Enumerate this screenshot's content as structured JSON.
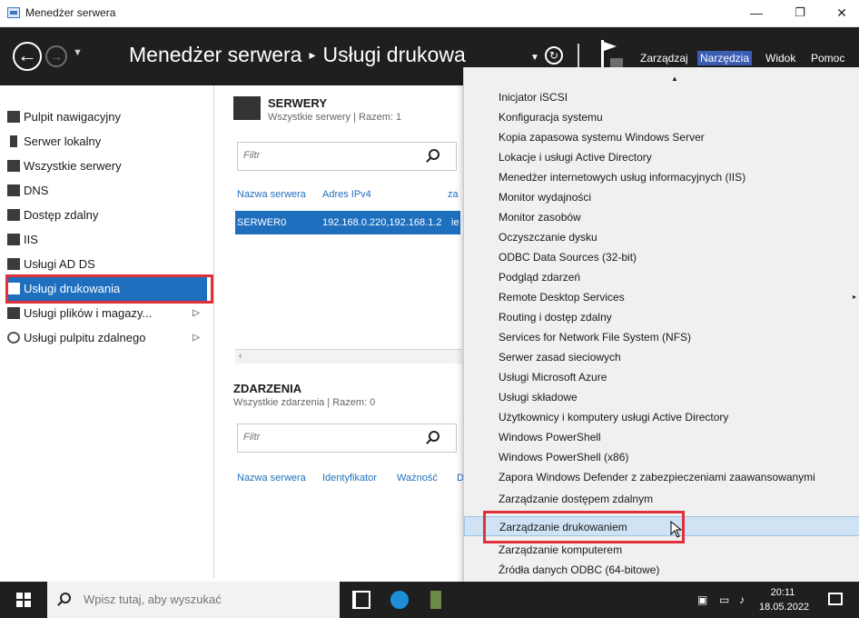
{
  "window": {
    "title": "Menedżer serwera",
    "minimize": "—",
    "maximize": "❐",
    "close": "✕"
  },
  "header": {
    "breadcrumb_root": "Menedżer serwera",
    "breadcrumb_sep": "▸",
    "breadcrumb_current": "Usługi drukowania",
    "menus": [
      "Zarządzaj",
      "Narzędzia",
      "Widok",
      "Pomoc"
    ],
    "active_menu": "Narzędzia"
  },
  "sidebar": {
    "items": [
      {
        "label": "Pulpit nawigacyjny",
        "icon": "dashboard-icon"
      },
      {
        "label": "Serwer lokalny",
        "icon": "server-icon"
      },
      {
        "label": "Wszystkie serwery",
        "icon": "servers-icon"
      },
      {
        "label": "DNS",
        "icon": "dns-icon"
      },
      {
        "label": "Dostęp zdalny",
        "icon": "remote-access-icon"
      },
      {
        "label": "IIS",
        "icon": "iis-icon"
      },
      {
        "label": "Usługi AD DS",
        "icon": "ad-ds-icon"
      },
      {
        "label": "Usługi drukowania",
        "icon": "printer-icon",
        "selected": true
      },
      {
        "label": "Usługi plików i magazy...",
        "icon": "file-storage-icon",
        "arrow": "▷"
      },
      {
        "label": "Usługi pulpitu zdalnego",
        "icon": "remote-desktop-icon",
        "arrow": "▷"
      }
    ]
  },
  "servers_tile": {
    "title": "SERWERY",
    "subtitle": "Wszystkie serwery | Razem: 1",
    "filter_placeholder": "Filtr",
    "columns": [
      "Nazwa serwera",
      "Adres IPv4",
      "za"
    ],
    "rows": [
      {
        "name": "SERWER0",
        "ipv4": "192.168.0.220,192.168.1.2",
        "extra": "ie"
      }
    ]
  },
  "events_tile": {
    "title": "ZDARZENIA",
    "subtitle": "Wszystkie zdarzenia | Razem: 0",
    "filter_placeholder": "Filtr",
    "columns": [
      "Nazwa serwera",
      "Identyfikator",
      "Ważność",
      "D"
    ]
  },
  "tools_menu": {
    "items": [
      "Inicjator iSCSI",
      "Konfiguracja systemu",
      "Kopia zapasowa systemu Windows Server",
      "Lokacje i usługi Active Directory",
      "Menedżer internetowych usług informacyjnych (IIS)",
      "Monitor wydajności",
      "Monitor zasobów",
      "Oczyszczanie dysku",
      "ODBC Data Sources (32-bit)",
      "Podgląd zdarzeń",
      "Remote Desktop Services",
      "Routing i dostęp zdalny",
      "Services for Network File System (NFS)",
      "Serwer zasad sieciowych",
      "Usługi Microsoft Azure",
      "Usługi składowe",
      "Użytkownicy i komputery usługi Active Directory",
      "Windows PowerShell",
      "Windows PowerShell (x86)",
      "Zapora Windows Defender z zabezpieczeniami zaawansowanymi",
      "Zarządzanie dostępem zdalnym",
      "Zarządzanie drukowaniem",
      "Zarządzanie komputerem",
      "Źródła danych ODBC (64-bitowe)"
    ],
    "submenu_marker": "▸",
    "highlighted": "Zarządzanie drukowaniem"
  },
  "taskbar": {
    "search_placeholder": "Wpisz tutaj, aby wyszukać",
    "time": "20:11",
    "date": "18.05.2022"
  },
  "colors": {
    "accent": "#1f6fbf",
    "header_bg": "#1f1f1f",
    "highlight_box": "#e0303a",
    "menu_active": "#3c5db4"
  }
}
